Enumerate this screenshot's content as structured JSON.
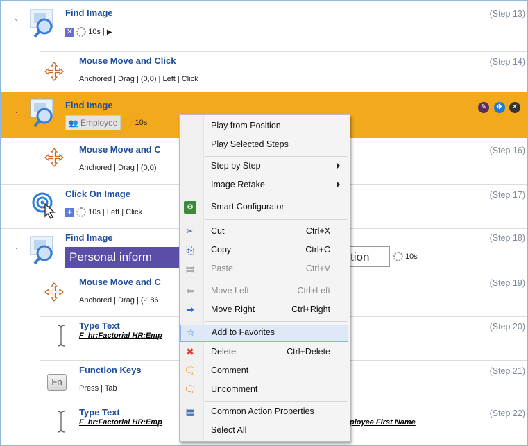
{
  "steps": [
    {
      "title": "Find Image",
      "step": "(Step 13)",
      "timer": "10s"
    },
    {
      "title": "Mouse Move and Click",
      "step": "(Step 14)",
      "details": "Anchored | Drag | (0,0) | Left | Click"
    },
    {
      "title": "Find Image",
      "step": "",
      "employee": "Employee",
      "timer": "10s"
    },
    {
      "title": "Mouse Move and C",
      "step": "(Step 16)",
      "details": "Anchored | Drag | (0,0)"
    },
    {
      "title": "Click On Image",
      "step": "(Step 17)",
      "details": "10s | Left | Click"
    },
    {
      "title": "Find Image",
      "step": "(Step 18)",
      "banner_left": "Personal inform",
      "banner_right": "tion",
      "timer": "10s"
    },
    {
      "title": "Mouse Move and C",
      "step": "(Step 19)",
      "details": "Anchored | Drag | (-186"
    },
    {
      "title": "Type Text",
      "step": "(Step 20)",
      "details": "F_hr:Factorial HR:Emp"
    },
    {
      "title": "Function Keys",
      "step": "(Step 21)",
      "details": "Press | Tab",
      "fn": "Fn"
    },
    {
      "title": "Type Text",
      "step": "(Step 22)",
      "details": "F_hr:Factorial HR:Emp",
      "details_right": "ployee First Name"
    }
  ],
  "menu": {
    "items": [
      {
        "label": "Play from Position",
        "shortcut": ""
      },
      {
        "label": "Play Selected Steps",
        "shortcut": ""
      },
      {
        "label": "Step by Step",
        "shortcut": ""
      },
      {
        "label": "Image Retake",
        "shortcut": ""
      },
      {
        "label": "Smart Configurator",
        "shortcut": ""
      },
      {
        "label": "Cut",
        "shortcut": "Ctrl+X"
      },
      {
        "label": "Copy",
        "shortcut": "Ctrl+C"
      },
      {
        "label": "Paste",
        "shortcut": "Ctrl+V"
      },
      {
        "label": "Move Left",
        "shortcut": "Ctrl+Left"
      },
      {
        "label": "Move Right",
        "shortcut": "Ctrl+Right"
      },
      {
        "label": "Add to Favorites",
        "shortcut": ""
      },
      {
        "label": "Delete",
        "shortcut": "Ctrl+Delete"
      },
      {
        "label": "Comment",
        "shortcut": ""
      },
      {
        "label": "Uncomment",
        "shortcut": ""
      },
      {
        "label": "Common Action Properties",
        "shortcut": ""
      },
      {
        "label": "Select All",
        "shortcut": ""
      }
    ]
  },
  "colors": {
    "selected": "#f2a91c",
    "title": "#1f4e9e",
    "accent": "#3a7bd5"
  }
}
